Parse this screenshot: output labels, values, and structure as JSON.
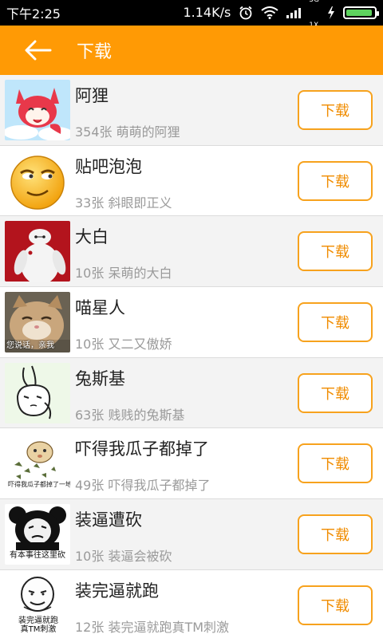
{
  "statusbar": {
    "time": "下午2:25",
    "speed": "1.14K/s",
    "net_top": "3G",
    "net_bottom": "1X",
    "battery_level": 0.95,
    "icons": [
      "alarm-icon",
      "wifi-icon",
      "signal-icon",
      "charging-icon",
      "battery-icon"
    ]
  },
  "header": {
    "title": "下载",
    "back_icon": "back-arrow-icon",
    "bg_color": "#ff9a05"
  },
  "items": [
    {
      "name": "阿狸",
      "desc": "354张 萌萌的阿狸",
      "button": "下载",
      "thumb": "ali-fox-thumbnail"
    },
    {
      "name": "贴吧泡泡",
      "desc": "33张 斜眼即正义",
      "button": "下载",
      "thumb": "tieba-bubble-thumbnail"
    },
    {
      "name": "大白",
      "desc": "10张 呆萌的大白",
      "button": "下载",
      "thumb": "baymax-thumbnail"
    },
    {
      "name": "喵星人",
      "desc": "10张 又二又傲娇",
      "button": "下载",
      "thumb": "cat-thumbnail",
      "caption": "您说话，亲我"
    },
    {
      "name": "兔斯基",
      "desc": "63张 贱贱的兔斯基",
      "button": "下载",
      "thumb": "tuzki-thumbnail"
    },
    {
      "name": "吓得我瓜子都掉了",
      "desc": "49张 吓得我瓜子都掉了",
      "button": "下载",
      "thumb": "hamster-thumbnail",
      "caption": "吓得我瓜子都掉了一地"
    },
    {
      "name": "装逼遭砍",
      "desc": "10张 装逼会被砍",
      "button": "下载",
      "thumb": "panda-meme-thumbnail",
      "caption": "有本事往这里砍"
    },
    {
      "name": "装完逼就跑",
      "desc": "12张 装完逼就跑真TM刺激",
      "button": "下载",
      "thumb": "bald-meme-thumbnail",
      "caption": "装完逼就跑真TM刺激"
    }
  ],
  "accent_color": "#f7a21d"
}
